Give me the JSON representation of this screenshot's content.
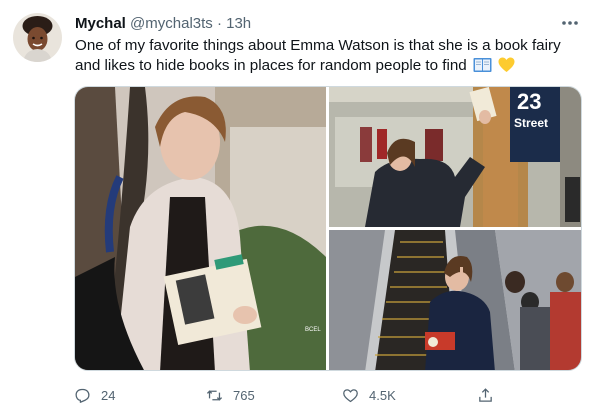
{
  "tweet": {
    "author_name": "Mychal",
    "author_handle": "@mychal3ts",
    "separator": "·",
    "time": "13h",
    "text": "One of my favorite things about Emma Watson is that she is a book fairy and likes to hide books in places for random people to find",
    "emojis": [
      "book-emoji",
      "yellow-heart-emoji"
    ]
  },
  "media": {
    "images": [
      {
        "name": "woman-holding-books-photo",
        "watermark": "BCEL"
      },
      {
        "name": "subway-station-photo",
        "sign_number": "23",
        "sign_word": "Street"
      },
      {
        "name": "escalator-photo"
      }
    ]
  },
  "actions": {
    "reply_count": "24",
    "retweet_count": "765",
    "like_count": "4.5K"
  },
  "icons": {
    "reply": "reply-icon",
    "retweet": "retweet-icon",
    "like": "heart-icon",
    "share": "share-icon",
    "more": "more-icon"
  }
}
